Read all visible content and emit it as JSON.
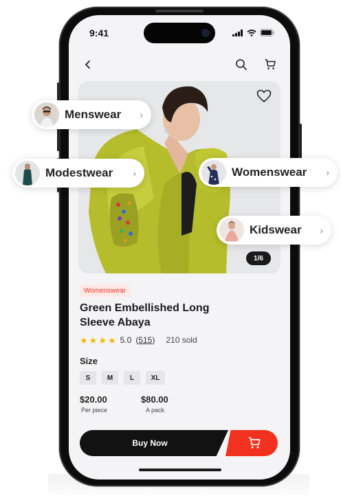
{
  "status_bar": {
    "time": "9:41"
  },
  "header": {
    "back_icon": "chevron-left-icon",
    "search_icon": "search-icon",
    "cart_icon": "cart-icon"
  },
  "product": {
    "image_counter": "1/6",
    "category_badge": "Womenswear",
    "title": "Green Embellished Long Sleeve Abaya",
    "rating": "5.0",
    "review_count": "515",
    "sold": "210 sold",
    "stars": 5,
    "size_label": "Size",
    "sizes": [
      "S",
      "M",
      "L",
      "XL"
    ],
    "prices": [
      {
        "amount": "$20.00",
        "unit": "Per piece"
      },
      {
        "amount": "$80.00",
        "unit": "A pack"
      }
    ]
  },
  "actions": {
    "buy_now": "Buy Now"
  },
  "categories": [
    {
      "label": "Menswear"
    },
    {
      "label": "Modestwear"
    },
    {
      "label": "Womenswear"
    },
    {
      "label": "Kidswear"
    }
  ],
  "colors": {
    "accent": "#f2321e",
    "badge_bg": "#fde8e6",
    "garment": "#b9bf2f",
    "star": "#f5b800"
  }
}
